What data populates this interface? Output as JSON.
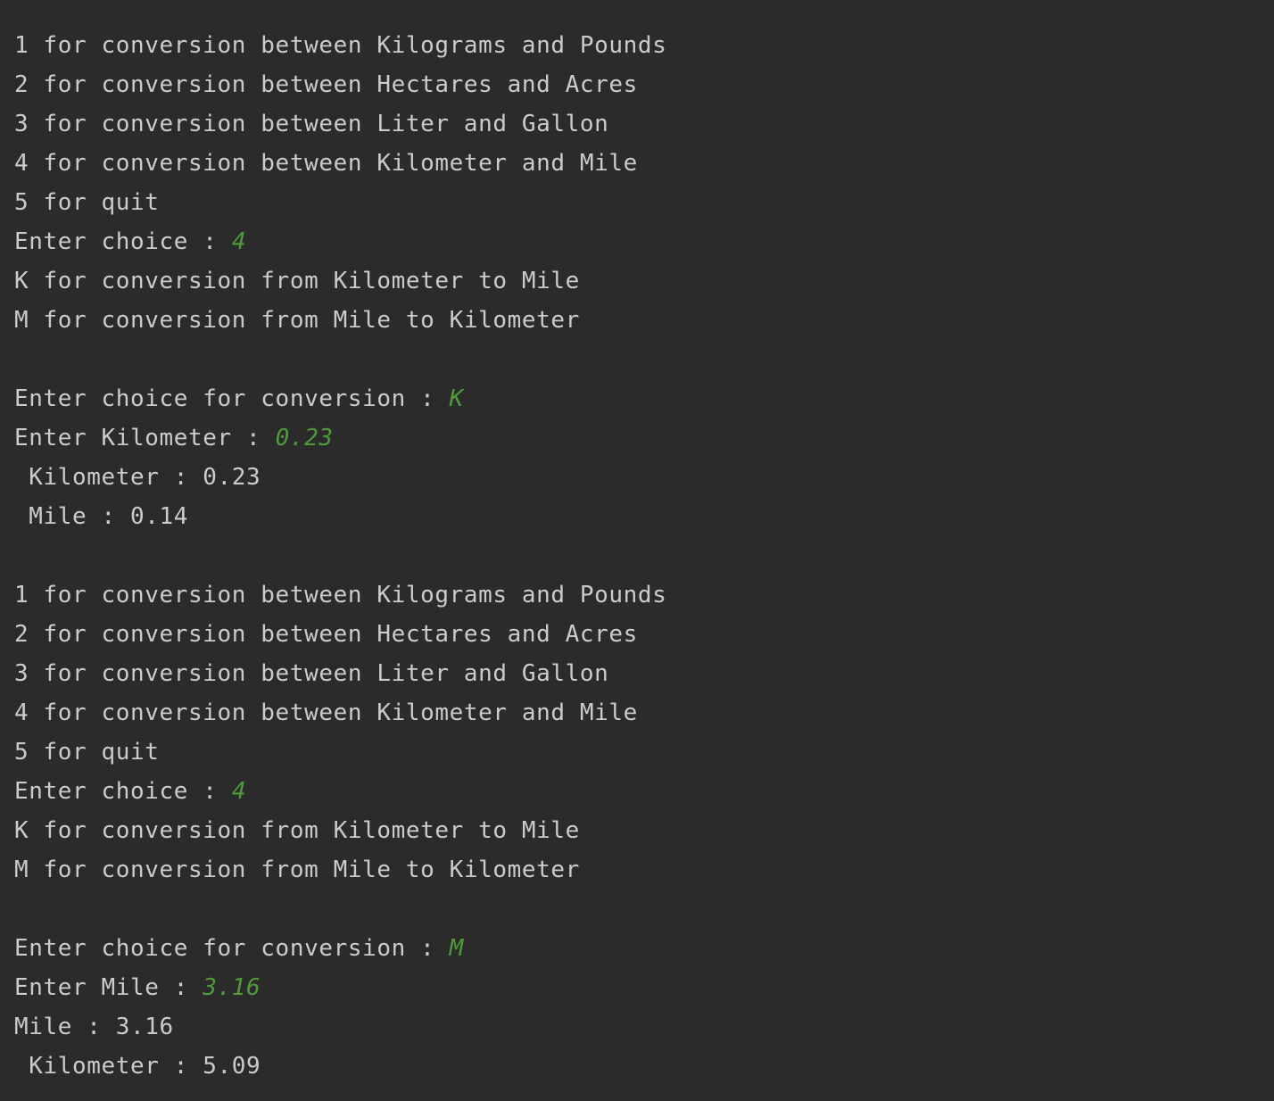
{
  "colors": {
    "background": "#2b2b2b",
    "output_text": "#c9cbcd",
    "user_input": "#4f9a3b"
  },
  "console": {
    "lines": [
      {
        "text": "1 for conversion between Kilograms and Pounds",
        "input": ""
      },
      {
        "text": "2 for conversion between Hectares and Acres",
        "input": ""
      },
      {
        "text": "3 for conversion between Liter and Gallon",
        "input": ""
      },
      {
        "text": "4 for conversion between Kilometer and Mile",
        "input": ""
      },
      {
        "text": "5 for quit",
        "input": ""
      },
      {
        "text": "Enter choice : ",
        "input": "4"
      },
      {
        "text": "K for conversion from Kilometer to Mile",
        "input": ""
      },
      {
        "text": "M for conversion from Mile to Kilometer",
        "input": ""
      },
      {
        "text": "",
        "input": ""
      },
      {
        "text": "Enter choice for conversion : ",
        "input": "K"
      },
      {
        "text": "Enter Kilometer : ",
        "input": "0.23"
      },
      {
        "text": " Kilometer : 0.23",
        "input": ""
      },
      {
        "text": " Mile : 0.14",
        "input": ""
      },
      {
        "text": "",
        "input": ""
      },
      {
        "text": "1 for conversion between Kilograms and Pounds",
        "input": ""
      },
      {
        "text": "2 for conversion between Hectares and Acres",
        "input": ""
      },
      {
        "text": "3 for conversion between Liter and Gallon",
        "input": ""
      },
      {
        "text": "4 for conversion between Kilometer and Mile",
        "input": ""
      },
      {
        "text": "5 for quit",
        "input": ""
      },
      {
        "text": "Enter choice : ",
        "input": "4"
      },
      {
        "text": "K for conversion from Kilometer to Mile",
        "input": ""
      },
      {
        "text": "M for conversion from Mile to Kilometer",
        "input": ""
      },
      {
        "text": "",
        "input": ""
      },
      {
        "text": "Enter choice for conversion : ",
        "input": "M"
      },
      {
        "text": "Enter Mile : ",
        "input": "3.16"
      },
      {
        "text": "Mile : 3.16",
        "input": ""
      },
      {
        "text": " Kilometer : 5.09",
        "input": ""
      }
    ]
  }
}
